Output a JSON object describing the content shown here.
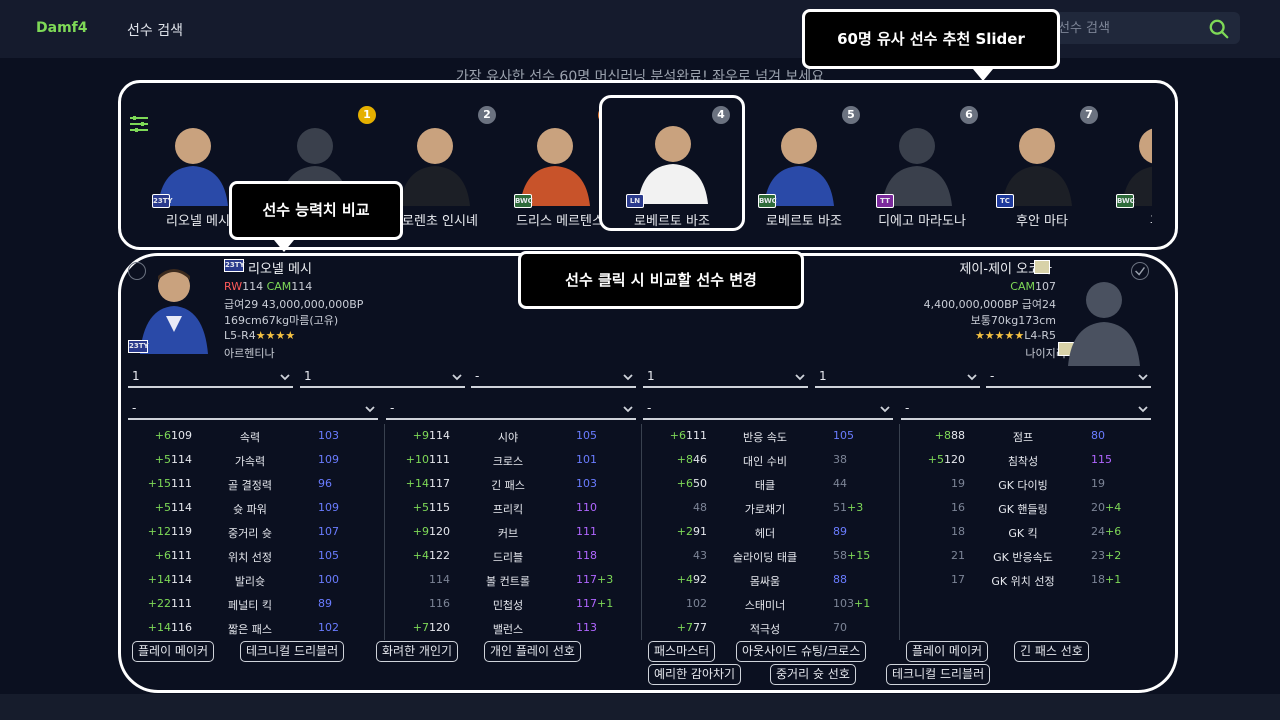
{
  "nav": {
    "brand": "Damf4",
    "menu_search": "선수 검색",
    "search_placeholder": "선수 검색"
  },
  "tagline": "가장 유사한 선수 60명 머신러닝 분석완료! 좌우로 넘겨 보세요",
  "callouts": {
    "slider": "60명 유사 선수 추천 Slider",
    "compare": "선수 능력치 비교",
    "click": "선수 클릭 시 비교할 선수 변경"
  },
  "slider": {
    "cards": [
      {
        "name": "리오넬 메시",
        "rank": "",
        "season": "23TY",
        "season_color": "#2a3a8c"
      },
      {
        "name": "",
        "rank": "1",
        "season": "",
        "rank_color": "#e5b000"
      },
      {
        "name": "로렌초 인시녜",
        "rank": "2",
        "season": "",
        "rank_color": "#6b7280"
      },
      {
        "name": "드리스 메르텐스",
        "rank": "3",
        "season": "BWC",
        "rank_color": "#e8772e",
        "season_color": "#2e6b3a"
      },
      {
        "name": "로베르토 바조",
        "rank": "4",
        "season": "LN",
        "rank_color": "#6b7280",
        "season_color": "#2a3a8c"
      },
      {
        "name": "로베르토 바조",
        "rank": "5",
        "season": "BWC",
        "rank_color": "#6b7280",
        "season_color": "#2e6b3a"
      },
      {
        "name": "디에고 마라도나",
        "rank": "6",
        "season": "TT",
        "rank_color": "#6b7280",
        "season_color": "#7b2a9c"
      },
      {
        "name": "후안 마타",
        "rank": "7",
        "season": "TC",
        "rank_color": "#6b7280",
        "season_color": "#1e3a9c"
      },
      {
        "name": "후안",
        "rank": "",
        "season": "BWC",
        "season_color": "#2e6b3a"
      }
    ]
  },
  "left_player": {
    "season": "23TY",
    "name": "리오넬 메시",
    "pos1": "RW",
    "pos1_val": "114",
    "pos2": "CAM",
    "pos2_val": "114",
    "salary_price": "급여29 43,000,000,000BP",
    "body": "169cm67kg마름(고유)",
    "foot": "L5-R4",
    "stars": "★★★★",
    "nation": "아르헨티나"
  },
  "right_player": {
    "name": "제이-제이 오코차",
    "pos": "CAM",
    "pos_val": "107",
    "price_salary": "4,400,000,000BP 급여24",
    "body": "보통70kg173cm",
    "stars": "★★★★★",
    "foot": "L4-R5",
    "nation": "나이지리아"
  },
  "selects_row1": [
    "1",
    "1",
    "-",
    "1",
    "1",
    "-"
  ],
  "selects_row2": [
    "-",
    "-",
    "-",
    "-"
  ],
  "stats": [
    [
      {
        "d": "+6",
        "a": "109",
        "n": "속력",
        "b": "103"
      },
      {
        "d": "+5",
        "a": "114",
        "n": "가속력",
        "b": "109"
      },
      {
        "d": "+15",
        "a": "111",
        "n": "골 결정력",
        "b": "96"
      },
      {
        "d": "+5",
        "a": "114",
        "n": "슛 파워",
        "b": "109"
      },
      {
        "d": "+12",
        "a": "119",
        "n": "중거리 슛",
        "b": "107"
      },
      {
        "d": "+6",
        "a": "111",
        "n": "위치 선정",
        "b": "105"
      },
      {
        "d": "+14",
        "a": "114",
        "n": "발리슛",
        "b": "100"
      },
      {
        "d": "+22",
        "a": "111",
        "n": "페널티 킥",
        "b": "89"
      },
      {
        "d": "+14",
        "a": "116",
        "n": "짧은 패스",
        "b": "102"
      }
    ],
    [
      {
        "d": "+9",
        "a": "114",
        "n": "시야",
        "b": "105"
      },
      {
        "d": "+10",
        "a": "111",
        "n": "크로스",
        "b": "101"
      },
      {
        "d": "+14",
        "a": "117",
        "n": "긴 패스",
        "b": "103"
      },
      {
        "d": "+5",
        "a": "115",
        "n": "프리킥",
        "b": "110"
      },
      {
        "d": "+9",
        "a": "120",
        "n": "커브",
        "b": "111"
      },
      {
        "d": "+4",
        "a": "122",
        "n": "드리블",
        "b": "118"
      },
      {
        "d": "",
        "a": "114",
        "n": "볼 컨트롤",
        "b": "117",
        "bd": "+3"
      },
      {
        "d": "",
        "a": "116",
        "n": "민첩성",
        "b": "117",
        "bd": "+1"
      },
      {
        "d": "+7",
        "a": "120",
        "n": "밸런스",
        "b": "113"
      }
    ],
    [
      {
        "d": "+6",
        "a": "111",
        "n": "반응 속도",
        "b": "105"
      },
      {
        "d": "+8",
        "a": "46",
        "n": "대인 수비",
        "b": "38"
      },
      {
        "d": "+6",
        "a": "50",
        "n": "태클",
        "b": "44"
      },
      {
        "d": "",
        "a": "48",
        "n": "가로채기",
        "b": "51",
        "bd": "+3"
      },
      {
        "d": "+2",
        "a": "91",
        "n": "헤더",
        "b": "89"
      },
      {
        "d": "",
        "a": "43",
        "n": "슬라이딩 태클",
        "b": "58",
        "bd": "+15"
      },
      {
        "d": "+4",
        "a": "92",
        "n": "몸싸움",
        "b": "88"
      },
      {
        "d": "",
        "a": "102",
        "n": "스태미너",
        "b": "103",
        "bd": "+1"
      },
      {
        "d": "+7",
        "a": "77",
        "n": "적극성",
        "b": "70"
      }
    ],
    [
      {
        "d": "+8",
        "a": "88",
        "n": "점프",
        "b": "80"
      },
      {
        "d": "+5",
        "a": "120",
        "n": "침착성",
        "b": "115"
      },
      {
        "d": "",
        "a": "19",
        "n": "GK 다이빙",
        "b": "19"
      },
      {
        "d": "",
        "a": "16",
        "n": "GK 핸들링",
        "b": "20",
        "bd": "+4"
      },
      {
        "d": "",
        "a": "18",
        "n": "GK 킥",
        "b": "24",
        "bd": "+6"
      },
      {
        "d": "",
        "a": "21",
        "n": "GK 반응속도",
        "b": "23",
        "bd": "+2"
      },
      {
        "d": "",
        "a": "17",
        "n": "GK 위치 선정",
        "b": "18",
        "bd": "+1"
      }
    ]
  ],
  "traits_left": [
    "플레이 메이커",
    "테크니컬 드리블러",
    "화려한 개인기",
    "개인 플레이 선호"
  ],
  "traits_right_row1": [
    "패스마스터",
    "아웃사이드 슈팅/크로스",
    "플레이 메이커",
    "긴 패스 선호"
  ],
  "traits_right_row2": [
    "예리한 감아차기",
    "중거리 슛 선호",
    "테크니컬 드리블러"
  ]
}
